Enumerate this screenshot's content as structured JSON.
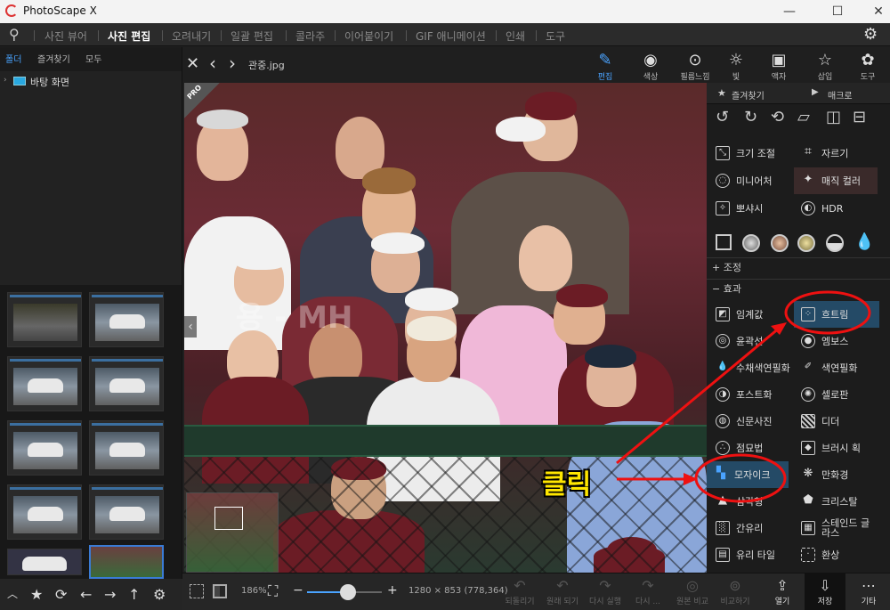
{
  "window": {
    "title": "PhotoScape X",
    "minimize": "—",
    "maximize": "☐",
    "close": "✕"
  },
  "menu": {
    "items": [
      "사진 뷰어",
      "사진 편집",
      "오려내기",
      "일괄 편집",
      "콜라주",
      "이어붙이기",
      "GIF 애니메이션",
      "인쇄",
      "도구"
    ],
    "active_index": 1
  },
  "left_tabs": [
    "폴더",
    "즐겨찾기",
    "모두"
  ],
  "tree": {
    "item": "바탕 화면"
  },
  "viewer": {
    "filename": "관중.jpg",
    "pro_badge": "PRO",
    "watermark": "용 - MH"
  },
  "top_tools": [
    {
      "label": "편집",
      "icon": "edit-icon"
    },
    {
      "label": "색상",
      "icon": "color-icon"
    },
    {
      "label": "필름느낌",
      "icon": "film-icon"
    },
    {
      "label": "빛",
      "icon": "light-icon"
    },
    {
      "label": "액자",
      "icon": "frame-icon"
    },
    {
      "label": "삽입",
      "icon": "insert-icon"
    },
    {
      "label": "도구",
      "icon": "tools-icon"
    }
  ],
  "right_panel": {
    "tabs": [
      "즐겨찾기",
      "매크로"
    ],
    "tools": [
      {
        "a": "크기 조절",
        "b": "자르기"
      },
      {
        "a": "미니어처",
        "b": "매직 컬러"
      },
      {
        "a": "뽀샤시",
        "b": "HDR"
      }
    ],
    "section_adjust": "조정",
    "section_effect": "효과",
    "effects": [
      {
        "a": "임계값",
        "b": "흐트림"
      },
      {
        "a": "윤곽선",
        "b": "엠보스"
      },
      {
        "a": "수채색연필화",
        "b": "색연필화"
      },
      {
        "a": "포스트화",
        "b": "셀로판"
      },
      {
        "a": "신문사진",
        "b": "디더"
      },
      {
        "a": "점묘법",
        "b": "브러시 획"
      },
      {
        "a": "모자이크",
        "b": "만화경"
      },
      {
        "a": "삼각형",
        "b": "크리스탈"
      },
      {
        "a": "간유리",
        "b": "스테인드 글라스"
      },
      {
        "a": "유리 타일",
        "b": "환상"
      }
    ]
  },
  "annotation": {
    "label": "클릭"
  },
  "bottom": {
    "zoom": "186%",
    "minus": "−",
    "plus": "+",
    "zoom_level": 0.55,
    "dimensions": "1280 × 853 (778,364)",
    "buttons": [
      "되돌리기",
      "원래 되기",
      "다시 실행",
      "다시 ...",
      "원본 비교",
      "비교하기"
    ],
    "open_label": "열기",
    "save_label": "저장",
    "more_label": "기타"
  },
  "colors": {
    "accent": "#4aa3ff",
    "highlight": "#244a66",
    "annotation_red": "#ee1111",
    "annotation_yellow": "#ffe600"
  }
}
